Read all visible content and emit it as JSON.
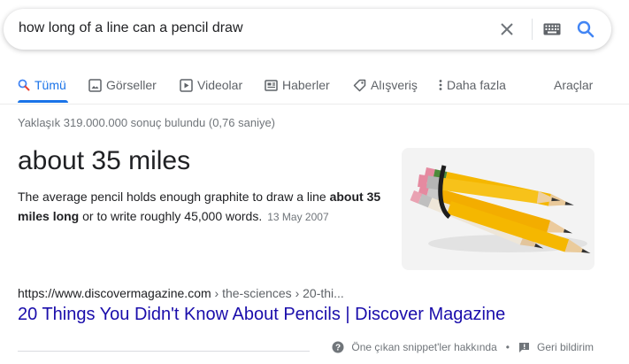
{
  "search": {
    "query": "how long of a line can a pencil draw"
  },
  "tabs": [
    {
      "label": "Tümü",
      "icon": "search-icon",
      "active": true
    },
    {
      "label": "Görseller",
      "icon": "image-icon"
    },
    {
      "label": "Videolar",
      "icon": "play-icon"
    },
    {
      "label": "Haberler",
      "icon": "newspaper-icon"
    },
    {
      "label": "Alışveriş",
      "icon": "tag-icon"
    },
    {
      "label": "Daha fazla",
      "icon": "more-vert-icon"
    }
  ],
  "tools_label": "Araçlar",
  "result_stats": "Yaklaşık 319.000.000 sonuç bulundu (0,76 saniye)",
  "featured": {
    "answer": "about 35 miles",
    "snippet_pre": "The average pencil holds enough graphite to draw a line ",
    "snippet_bold": "about 35 miles long",
    "snippet_post": " or to write roughly 45,000 words.",
    "date": "13 May 2007",
    "image_alt": "pencils"
  },
  "result": {
    "cite_domain": "https://www.discovermagazine.com",
    "cite_path": " › the-sciences › 20-thi...",
    "title": "20 Things You Didn't Know About Pencils | Discover Magazine"
  },
  "footer": {
    "about_label": "Öne çıkan snippet'ler hakkında",
    "separator": "•",
    "feedback_label": "Geri bildirim"
  },
  "colors": {
    "accent": "#1a73e8",
    "link": "#1a0dab",
    "pencil_yellow": "#f5b700"
  }
}
